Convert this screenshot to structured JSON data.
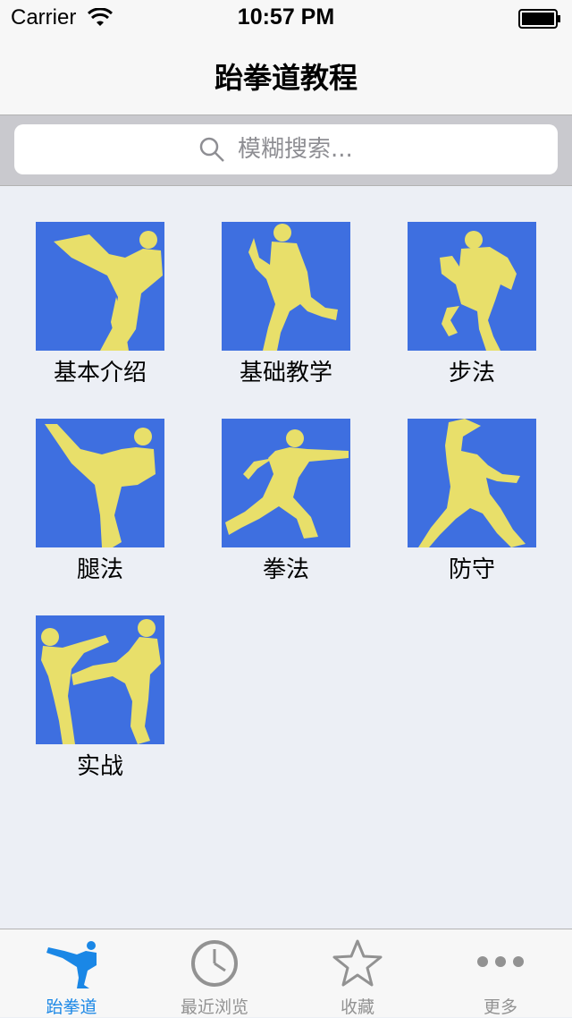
{
  "status_bar": {
    "carrier": "Carrier",
    "time": "10:57 PM"
  },
  "nav": {
    "title": "跆拳道教程"
  },
  "search": {
    "placeholder": "模糊搜索..."
  },
  "grid": {
    "items": [
      {
        "label": "基本介绍",
        "icon": "high-kick-icon"
      },
      {
        "label": "基础教学",
        "icon": "stance-icon"
      },
      {
        "label": "步法",
        "icon": "knee-raise-icon"
      },
      {
        "label": "腿法",
        "icon": "side-kick-icon"
      },
      {
        "label": "拳法",
        "icon": "punch-icon"
      },
      {
        "label": "防守",
        "icon": "defense-icon"
      },
      {
        "label": "实战",
        "icon": "sparring-icon"
      }
    ]
  },
  "tabs": [
    {
      "label": "跆拳道",
      "icon": "kicker-icon",
      "active": true
    },
    {
      "label": "最近浏览",
      "icon": "clock-icon",
      "active": false
    },
    {
      "label": "收藏",
      "icon": "star-icon",
      "active": false
    },
    {
      "label": "更多",
      "icon": "more-icon",
      "active": false
    }
  ],
  "colors": {
    "tile": "#3e6fe0",
    "figure": "#e8df6a",
    "active_tab": "#1a87e6",
    "inactive_tab": "#929292"
  }
}
